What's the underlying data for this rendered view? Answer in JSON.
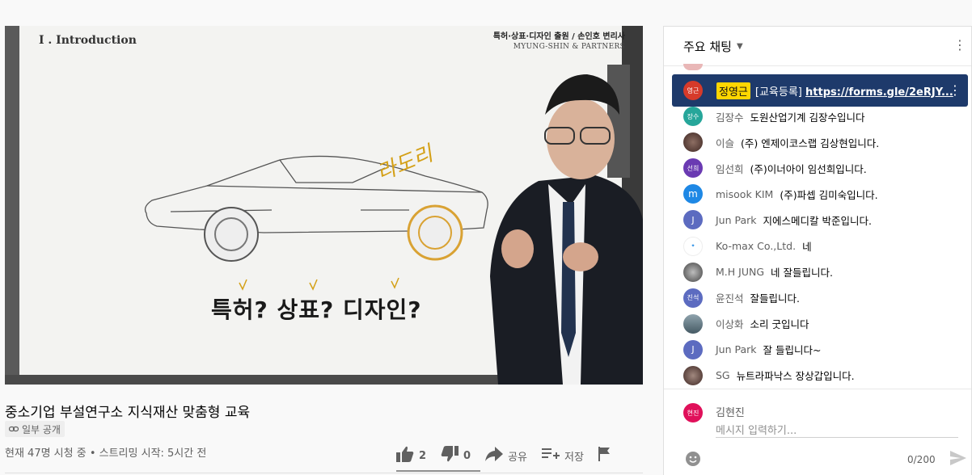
{
  "video": {
    "board_header": "I . Introduction",
    "board_subtitle": "특허·상표·디자인 출원 / 손인호 변리사",
    "board_firm": "MYUNG-SHIN & PARTNERS",
    "board_question": "특허? 상표? 디자인?",
    "scribble": "라도리"
  },
  "title": "중소기업 부설연구소 지식재산 맞춤형 교육",
  "privacy": "일부 공개",
  "meta": "현재 47명 시청 중 • 스트리밍 시작: 5시간 전",
  "actions": {
    "likes": "2",
    "dislikes": "0",
    "share": "공유",
    "save": "저장"
  },
  "chat": {
    "header": "주요 채팅",
    "pinned": {
      "avatar": "영근",
      "author": "정영근",
      "text": "[교육등록]",
      "link": "https://forms.gle/2eRJY..."
    },
    "messages": [
      {
        "avatar": "장수",
        "name": "김장수",
        "text": "도원산업기계 김장수입니다",
        "color": "#26a69a"
      },
      {
        "avatar": "",
        "name": "이슬",
        "text": "(주) 엔제이코스랩 김상현입니다.",
        "color": "#5d4037"
      },
      {
        "avatar": "선희",
        "name": "임선희",
        "text": "(주)이너아이 임선희입니다.",
        "color": "#6a3ab2"
      },
      {
        "avatar": "m",
        "name": "misook KIM",
        "text": "(주)파셉 김미숙입니다.",
        "color": "#1e88e5"
      },
      {
        "avatar": "J",
        "name": "Jun Park",
        "text": "지에스메디칼 박준입니다.",
        "color": "#5c6bc0"
      },
      {
        "avatar": "",
        "name": "Ko-max Co.,Ltd.",
        "text": "네",
        "color": "#ffffff"
      },
      {
        "avatar": "",
        "name": "M.H JUNG",
        "text": "네 잘들립니다.",
        "color": "#757575"
      },
      {
        "avatar": "진석",
        "name": "윤진석",
        "text": "잘들립니다.",
        "color": "#5c6bc0"
      },
      {
        "avatar": "",
        "name": "이상화",
        "text": "소리 굿입니다",
        "color": "#607d8b"
      },
      {
        "avatar": "J",
        "name": "Jun Park",
        "text": "잘 들립니다~",
        "color": "#5c6bc0"
      },
      {
        "avatar": "",
        "name": "SG",
        "text": "뉴트라파낙스 장상갑입니다.",
        "color": "#6d4c41"
      }
    ],
    "composer": {
      "avatar": "현진",
      "username": "김현진",
      "placeholder": "메시지 입력하기...",
      "counter": "0/200"
    }
  }
}
